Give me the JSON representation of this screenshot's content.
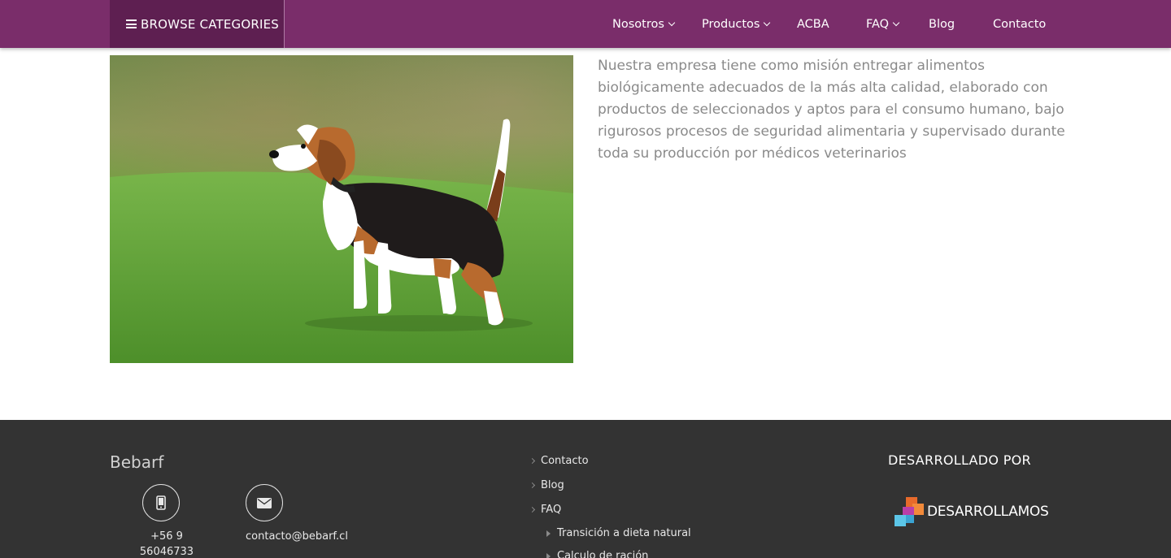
{
  "header": {
    "browse_label": "BROWSE CATEGORIES",
    "nav": [
      {
        "label": "Nosotros",
        "dropdown": true
      },
      {
        "label": "Productos",
        "dropdown": true
      },
      {
        "label": "ACBA",
        "dropdown": false
      },
      {
        "label": "FAQ",
        "dropdown": true
      },
      {
        "label": "Blog",
        "dropdown": false
      },
      {
        "label": "Contacto",
        "dropdown": false
      }
    ]
  },
  "main": {
    "mission_text": "Nuestra empresa tiene como misión entregar alimentos biológicamente adecuados de la más alta calidad, elaborado con productos de seleccionados y aptos para el consumo humano,  bajo rigurosos procesos de seguridad alimentaria y supervisado durante toda su producción por médicos veterinarios"
  },
  "footer": {
    "brand": "Bebarf",
    "phone": "+56 9 56046733",
    "email": "contacto@bebarf.cl",
    "links": [
      "Contacto",
      "Blog",
      "FAQ"
    ],
    "sublinks": [
      "Transición a dieta natural",
      "Calculo de ración"
    ],
    "developed_by": "DESARROLLADO POR",
    "developer": "DESARROLLAMOS"
  },
  "colors": {
    "header_bg": "#7a2d6a",
    "browse_bg": "#5e1f51",
    "footer_bg": "#333333",
    "mission_text": "#8a8a8a"
  },
  "icons": [
    "hamburger-icon",
    "chevron-down-icon",
    "phone-icon",
    "envelope-icon",
    "chevron-right-icon",
    "caret-right-icon",
    "cubes-logo-icon"
  ]
}
